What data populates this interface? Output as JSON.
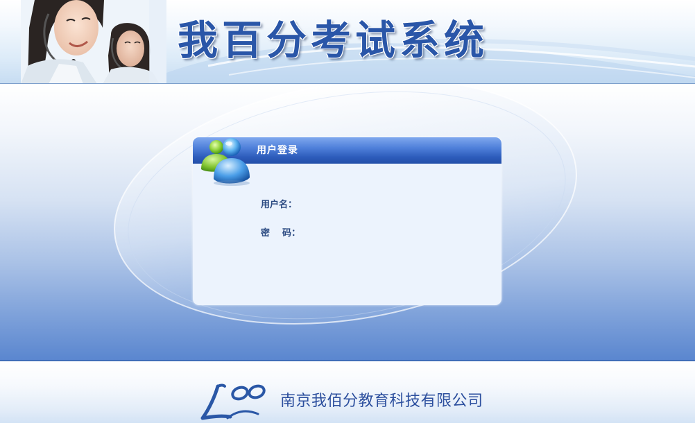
{
  "header": {
    "site_title": "我百分考试系统"
  },
  "login": {
    "title": "用户登录",
    "username_label": "用户名：",
    "password_label_part1": "密",
    "password_label_part2": "码：",
    "username_value": "",
    "password_value": ""
  },
  "footer": {
    "company_name": "南京我佰分教育科技有限公司"
  },
  "colors": {
    "title_blue": "#2a56a8",
    "panel_header_blue": "#2d5cbb",
    "panel_body": "#ecf3fd",
    "label_blue": "#2b4a82",
    "company_blue": "#2c4f9e",
    "main_bottom_blue": "#5a86cf"
  },
  "icons": {
    "header_image": "customer-service-agents-photo",
    "panel_icon": "users-icon",
    "footer_logo": "company-logo-icon"
  }
}
